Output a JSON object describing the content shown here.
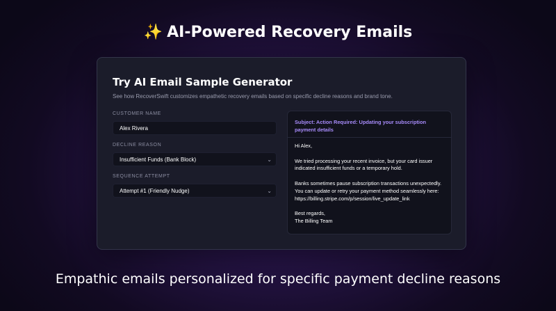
{
  "headline": {
    "icon": "sparkles-icon",
    "emoji": "✨",
    "text": "AI-Powered Recovery Emails"
  },
  "panel": {
    "title": "Try AI Email Sample Generator",
    "description": "See how RecoverSwift customizes empathetic recovery emails based on specific decline reasons and brand tone.",
    "customer_name": {
      "label": "CUSTOMER NAME",
      "value": "Alex Rivera"
    },
    "decline_reason": {
      "label": "DECLINE REASON",
      "value": "Insufficient Funds (Bank Block)"
    },
    "sequence_attempt": {
      "label": "SEQUENCE ATTEMPT",
      "value": "Attempt #1 (Friendly Nudge)"
    }
  },
  "email": {
    "subject": "Subject: Action Required: Updating your subscription payment details",
    "body": "Hi Alex,\n\nWe tried processing your recent invoice, but your card issuer indicated insufficient funds or a temporary hold.\n\nBanks sometimes pause subscription transactions unexpectedly. You can update or retry your payment method seamlessly here: https://billing.stripe.com/p/session/live_update_link\n\nBest regards,\nThe Billing Team"
  },
  "tagline": "Empathic emails personalized for specific payment decline reasons",
  "colors": {
    "accent": "#a78bfa",
    "sparkle": "#f4c430",
    "panel_bg": "#1b1c2a",
    "field_bg": "#11121c"
  }
}
